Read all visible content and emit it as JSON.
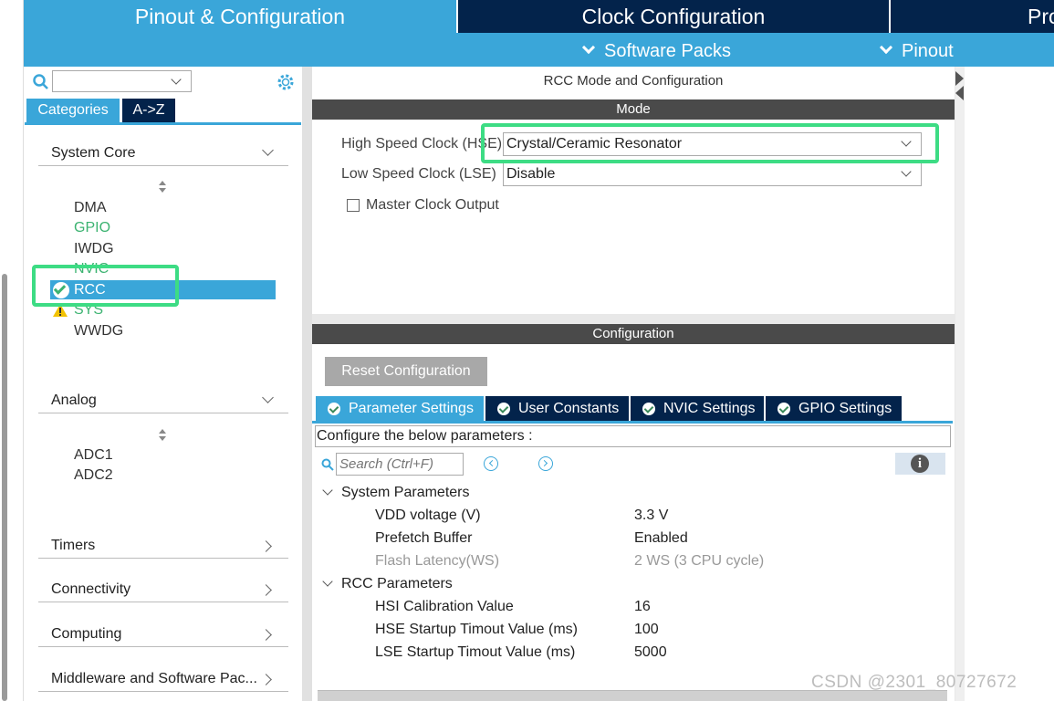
{
  "top_tabs": [
    "Pinout & Configuration",
    "Clock Configuration",
    "Pro"
  ],
  "sub_bar": {
    "software_packs": "Software Packs",
    "pinout": "Pinout"
  },
  "left": {
    "category_tabs": [
      "Categories",
      "A->Z"
    ],
    "sections": {
      "system_core": "System Core",
      "analog": "Analog",
      "timers": "Timers",
      "connectivity": "Connectivity",
      "computing": "Computing",
      "middleware": "Middleware and Software Pac..."
    },
    "system_core_items": [
      "DMA",
      "GPIO",
      "IWDG",
      "NVIC",
      "RCC",
      "SYS",
      "WWDG"
    ],
    "analog_items": [
      "ADC1",
      "ADC2"
    ]
  },
  "mode_panel": {
    "title": "RCC Mode and Configuration",
    "mode_header": "Mode",
    "hse_label": "High Speed Clock (HSE)",
    "hse_value": "Crystal/Ceramic Resonator",
    "lse_label": "Low Speed Clock (LSE)",
    "lse_value": "Disable",
    "mco_label": "Master Clock Output"
  },
  "config_panel": {
    "header": "Configuration",
    "reset_button": "Reset Configuration",
    "tabs": [
      "Parameter Settings",
      "User Constants",
      "NVIC Settings",
      "GPIO Settings"
    ],
    "hint": "Configure the below parameters :",
    "search_placeholder": "Search (Ctrl+F)",
    "groups": [
      {
        "name": "System Parameters",
        "params": [
          {
            "name": "VDD voltage (V)",
            "value": "3.3 V"
          },
          {
            "name": "Prefetch Buffer",
            "value": "Enabled"
          },
          {
            "name": "Flash Latency(WS)",
            "value": "2 WS (3 CPU cycle)"
          }
        ]
      },
      {
        "name": "RCC Parameters",
        "params": [
          {
            "name": "HSI Calibration Value",
            "value": "16"
          },
          {
            "name": "HSE Startup Timout Value (ms)",
            "value": "100"
          },
          {
            "name": "LSE Startup Timout Value (ms)",
            "value": "5000"
          }
        ]
      }
    ]
  },
  "watermark": "CSDN @2301_80727672",
  "colors": {
    "accent": "#3aa6d9",
    "dark_navy": "#03234b",
    "highlight": "#3ddc84",
    "green_item": "#3cb371",
    "warning": "#f2c200"
  }
}
